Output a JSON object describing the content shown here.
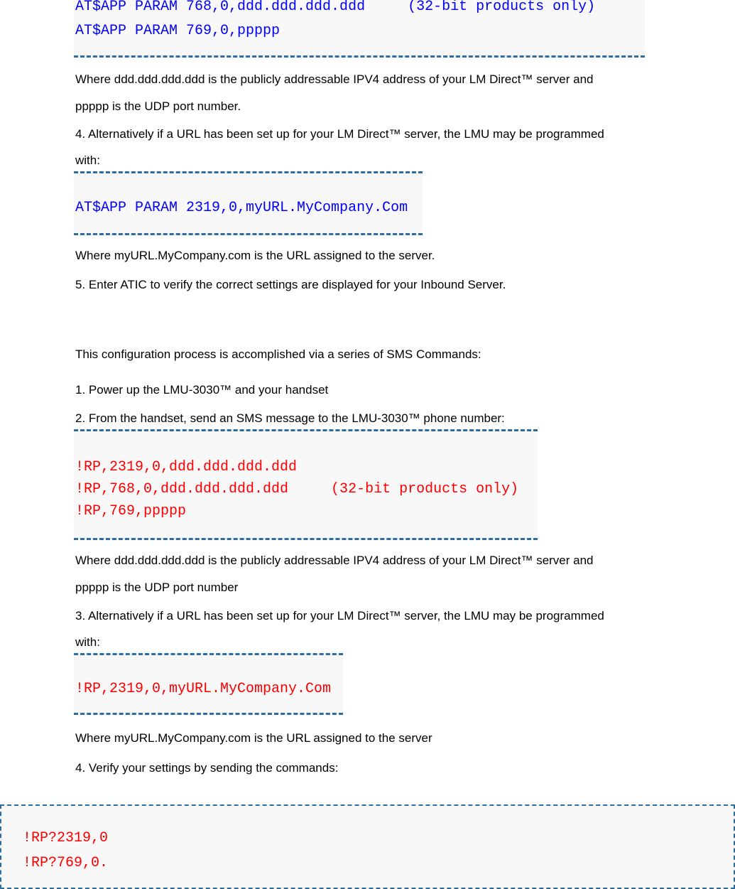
{
  "colors": {
    "at_command": "#0000ff",
    "sms_command": "#ff0000",
    "code_border": "#2e6da4",
    "code_bg": "#f8f8f8",
    "text": "#000000"
  },
  "at_section": {
    "code_block_1": {
      "lines": [
        "AT$APP PARAM 768,0,ddd.ddd.ddd.ddd     (32-bit products only)",
        "AT$APP PARAM 769,0,ppppp"
      ]
    },
    "para_where_ip_1": "Where ddd.ddd.ddd.ddd is the publicly addressable IPV4 address of your LM Direct™ server and",
    "para_where_ip_2": "ppppp is the UDP port number.",
    "step4_line1": "4. Alternatively if a URL has been set up for your LM Direct™ server, the LMU may be programmed",
    "step4_line2": "with:",
    "code_block_2": {
      "lines": [
        "AT$APP PARAM 2319,0,myURL.MyCompany.Com"
      ]
    },
    "para_where_url": "Where myURL.MyCompany.com is the URL assigned to the server.",
    "step5": "5. Enter ATIC to verify the correct settings are displayed for your Inbound Server."
  },
  "sms_section": {
    "intro": "This configuration process is accomplished via a series of SMS Commands:",
    "step1": "1. Power up the LMU-3030™ and your handset",
    "step2": "2. From the handset, send an SMS message to the LMU-3030™ phone number:",
    "code_block_3": {
      "lines": [
        "!RP,2319,0,ddd.ddd.ddd.ddd",
        "!RP,768,0,ddd.ddd.ddd.ddd     (32-bit products only)",
        "!RP,769,ppppp"
      ]
    },
    "para_where_ip_1": "Where ddd.ddd.ddd.ddd is the publicly addressable IPV4 address of your LM Direct™ server and",
    "para_where_ip_2": "ppppp is the UDP port number",
    "step3_line1": "3. Alternatively if a URL has been set up for your LM Direct™ server, the LMU may be programmed",
    "step3_line2": "with:",
    "code_block_4": {
      "lines": [
        "!RP,2319,0,myURL.MyCompany.Com"
      ]
    },
    "para_where_url": "Where myURL.MyCompany.com is the URL assigned to the server",
    "step4": "4. Verify your settings by sending the commands:",
    "code_block_5": {
      "lines": [
        "!RP?2319,0",
        "!RP?769,0."
      ]
    }
  }
}
